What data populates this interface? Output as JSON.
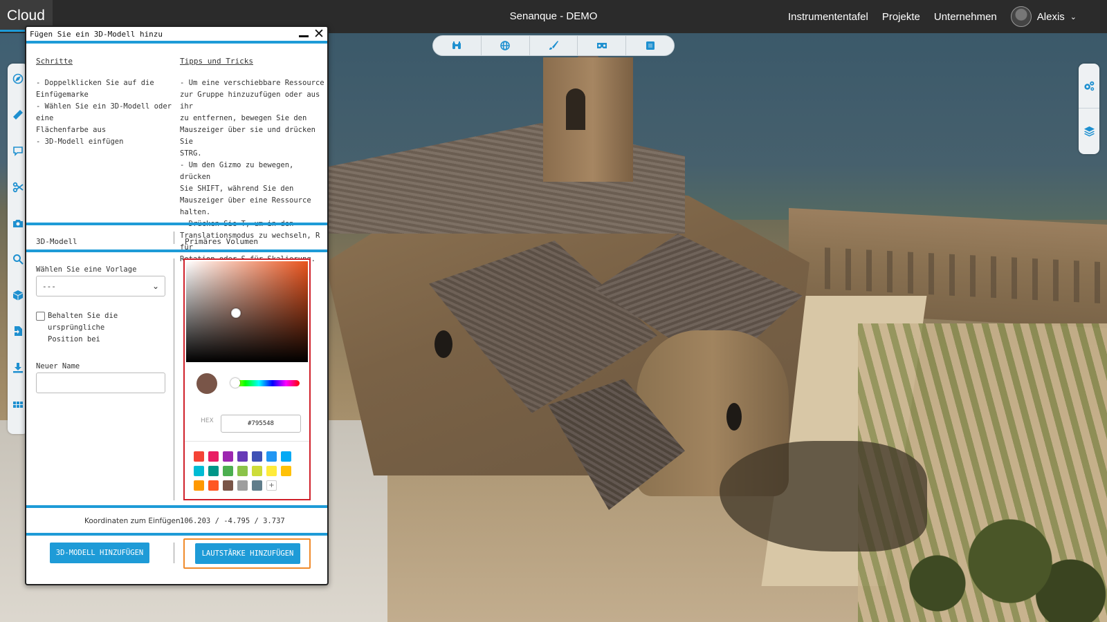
{
  "app": {
    "brand": "Cloud",
    "project_title": "Senanque - DEMO"
  },
  "nav": {
    "items": [
      "Instrumententafel",
      "Projekte",
      "Unternehmen"
    ],
    "user_name": "Alexis"
  },
  "toolbar": {
    "icons": [
      "binoculars-icon",
      "globe-icon",
      "brush-icon",
      "vr-headset-icon",
      "cube-icon"
    ]
  },
  "left_tools": {
    "icons": [
      "compass-icon",
      "ruler-icon",
      "comment-icon",
      "scissors-icon",
      "camera-icon",
      "search-icon",
      "cube-icon",
      "import-icon",
      "download-icon",
      "grid-icon"
    ]
  },
  "right_tools": {
    "icons": [
      "cogs-icon",
      "layers-icon"
    ]
  },
  "dialog": {
    "title": "Fügen Sie ein 3D-Modell hinzu",
    "steps_heading": "Schritte",
    "steps_text": "- Doppelklicken Sie auf die\nEinfügemarke\n- Wählen Sie ein 3D-Modell oder eine\nFlächenfarbe aus\n- 3D-Modell einfügen",
    "tips_heading": "Tipps und Tricks",
    "tips_text": "- Um eine verschiebbare Ressource\nzur Gruppe hinzuzufügen oder aus ihr\nzu entfernen, bewegen Sie den\nMauszeiger über sie und drücken Sie\nSTRG.\n- Um den Gizmo zu bewegen, drücken\nSie SHIFT, während Sie den\nMauszeiger über eine Ressource\nhalten.\n- Drücken Sie T, um in den\nTranslationsmodus zu wechseln, R für\nRotation oder S für Skalierung.",
    "section_model": "3D-Modell",
    "section_volume": "Primäres Volumen",
    "template_label": "Wählen Sie eine Vorlage",
    "template_value": "---",
    "keep_position_label": "Behalten Sie die ursprüngliche\nPosition bei",
    "keep_position_checked": false,
    "new_name_label": "Neuer Name",
    "new_name_value": "",
    "coords_label": "Koordinaten zum Einfügen",
    "coords_value": "106.203 / -4.795 / 3.737",
    "add_model_button": "3D-MODELL HINZUFÜGEN",
    "add_volume_button": "LAUTSTÄRKE HINZUFÜGEN"
  },
  "color_picker": {
    "hex_label": "HEX",
    "hex_value": "#795548",
    "current_color": "#795548",
    "plus_label": "+",
    "swatches": [
      "#f44336",
      "#e91e63",
      "#9c27b0",
      "#673ab7",
      "#3f51b5",
      "#2196f3",
      "#03a9f4",
      "#00bcd4",
      "#009688",
      "#4caf50",
      "#8bc34a",
      "#cddc39",
      "#ffeb3b",
      "#ffc107",
      "#ff9800",
      "#ff5722",
      "#795548",
      "#9e9e9e",
      "#607d8b"
    ]
  },
  "colors": {
    "accent": "#1e9bd7",
    "highlight_red": "#d0202a",
    "highlight_orange": "#f08a2a",
    "topbar": "#2b2b2b"
  }
}
